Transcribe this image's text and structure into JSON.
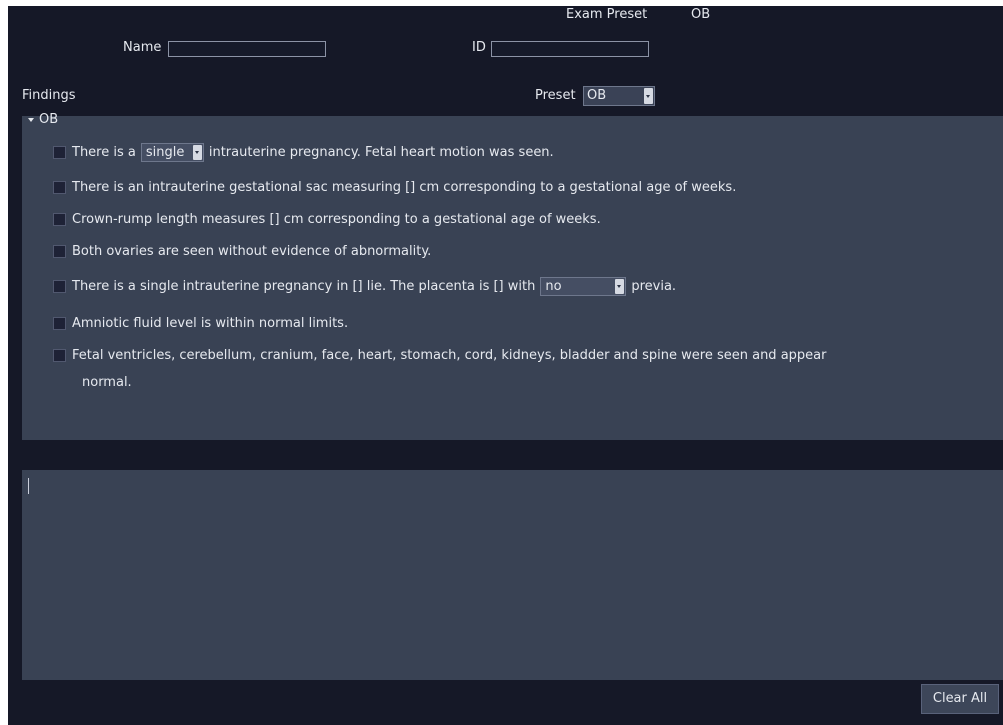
{
  "header": {
    "exam_preset_label": "Exam Preset",
    "exam_preset_value": "OB",
    "name_label": "Name",
    "name_value": "",
    "id_label": "ID",
    "id_value": ""
  },
  "findings": {
    "title": "Findings",
    "preset_label": "Preset",
    "preset_value": "OB",
    "group_label": "OB",
    "items": [
      {
        "before": "There is a",
        "select": "single",
        "after": "intrauterine pregnancy. Fetal heart motion was seen.",
        "checked": false
      },
      {
        "text": "There is an intrauterine gestational sac measuring [] cm corresponding to a gestational age of weeks.",
        "checked": false
      },
      {
        "text": "Crown-rump length measures [] cm corresponding to a gestational age of weeks.",
        "checked": false
      },
      {
        "text": "Both ovaries are seen without evidence of abnormality.",
        "checked": false
      },
      {
        "before": "There is a single intrauterine pregnancy in [] lie. The placenta is [] with",
        "select": "no",
        "after": "previa.",
        "checked": false
      },
      {
        "text": "Amniotic fluid level is within normal limits.",
        "checked": false
      },
      {
        "text": "Fetal ventricles, cerebellum, cranium, face, heart, stomach, cord, kidneys, bladder and spine were seen and appear",
        "text_line2": "normal.",
        "checked": false
      }
    ]
  },
  "notes": {
    "value": ""
  },
  "footer": {
    "clear_all_label": "Clear All"
  },
  "colors": {
    "background": "#151827",
    "panel": "#394254",
    "text": "#e6e9ef"
  }
}
